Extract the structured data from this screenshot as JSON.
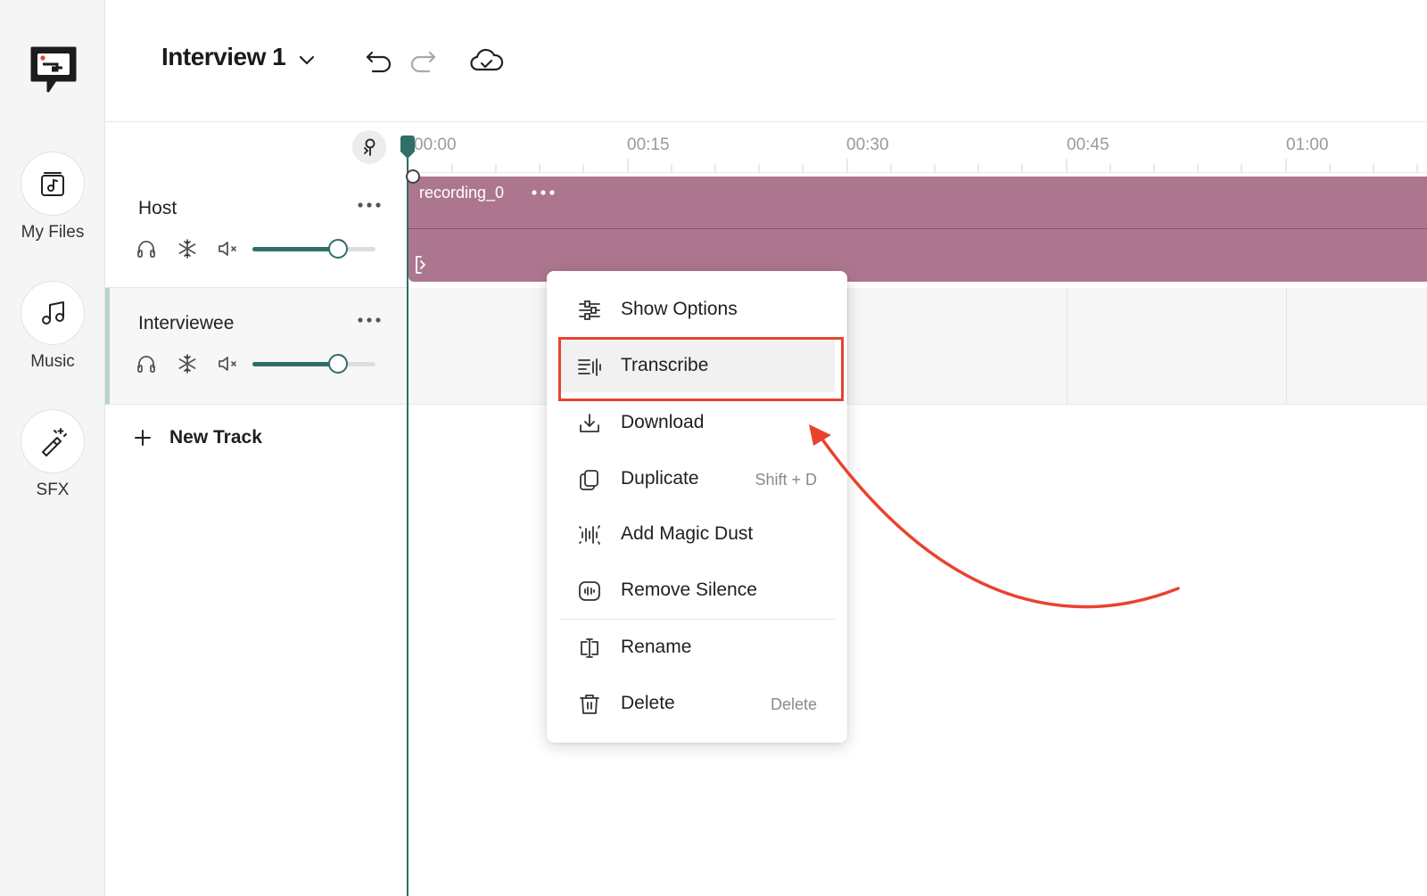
{
  "colors": {
    "accent": "#2e6f68",
    "clip": "#ad768f",
    "annotation": "#e8432f"
  },
  "sidebar": {
    "logo_icon": "speech-bubble-logo-icon",
    "items": [
      {
        "label": "My Files",
        "icon": "music-file-icon"
      },
      {
        "label": "Music",
        "icon": "music-note-icon"
      },
      {
        "label": "SFX",
        "icon": "magic-wand-icon"
      }
    ]
  },
  "header": {
    "project_title": "Interview 1",
    "icons": [
      "chevron-down-icon",
      "undo-icon",
      "redo-icon",
      "cloud-saved-icon"
    ]
  },
  "ruler": {
    "ticks": [
      "00:00",
      "00:15",
      "00:30",
      "00:45",
      "01:00"
    ]
  },
  "tracks": [
    {
      "name": "Host",
      "volume": 0.7,
      "controls": [
        "headphones-icon",
        "snowflake-icon",
        "mute-icon"
      ]
    },
    {
      "name": "Interviewee",
      "volume": 0.7,
      "controls": [
        "headphones-icon",
        "snowflake-icon",
        "mute-icon"
      ]
    }
  ],
  "new_track_label": "New Track",
  "clip": {
    "name": "recording_0"
  },
  "context_menu": {
    "items": [
      {
        "label": "Show Options",
        "icon": "sliders-icon",
        "shortcut": ""
      },
      {
        "label": "Transcribe",
        "icon": "transcribe-icon",
        "shortcut": ""
      },
      {
        "label": "Download",
        "icon": "download-icon",
        "shortcut": ""
      },
      {
        "label": "Duplicate",
        "icon": "duplicate-icon",
        "shortcut": "Shift + D"
      },
      {
        "label": "Add Magic Dust",
        "icon": "magic-dust-icon",
        "shortcut": ""
      },
      {
        "label": "Remove Silence",
        "icon": "remove-silence-icon",
        "shortcut": ""
      },
      {
        "label": "Rename",
        "icon": "rename-icon",
        "shortcut": ""
      },
      {
        "label": "Delete",
        "icon": "trash-icon",
        "shortcut": "Delete"
      }
    ],
    "highlighted_item": "Transcribe"
  }
}
